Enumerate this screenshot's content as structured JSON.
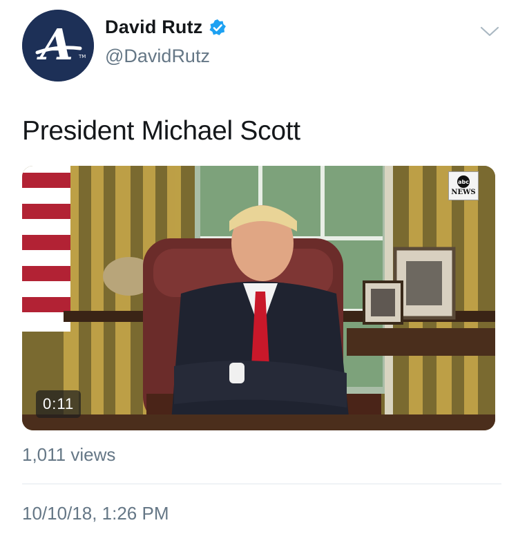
{
  "tweet": {
    "author": {
      "display_name": "David Rutz",
      "handle": "@DavidRutz",
      "verified_icon": "verified-badge-icon",
      "avatar_icon": "braves-a-logo-icon",
      "avatar_letter": "A",
      "avatar_tm": "TM"
    },
    "menu_icon": "chevron-down-icon",
    "text": "President Michael Scott",
    "media": {
      "type": "video",
      "duration": "0:11",
      "watermark_circle": "abc",
      "watermark_text": "NEWS"
    },
    "views": "1,011 views",
    "timestamp": "10/10/18, 1:26 PM"
  },
  "colors": {
    "avatar_bg": "#1d3057",
    "verified_blue": "#1da1f2",
    "secondary_text": "#657786",
    "divider": "#e1e8ed"
  }
}
